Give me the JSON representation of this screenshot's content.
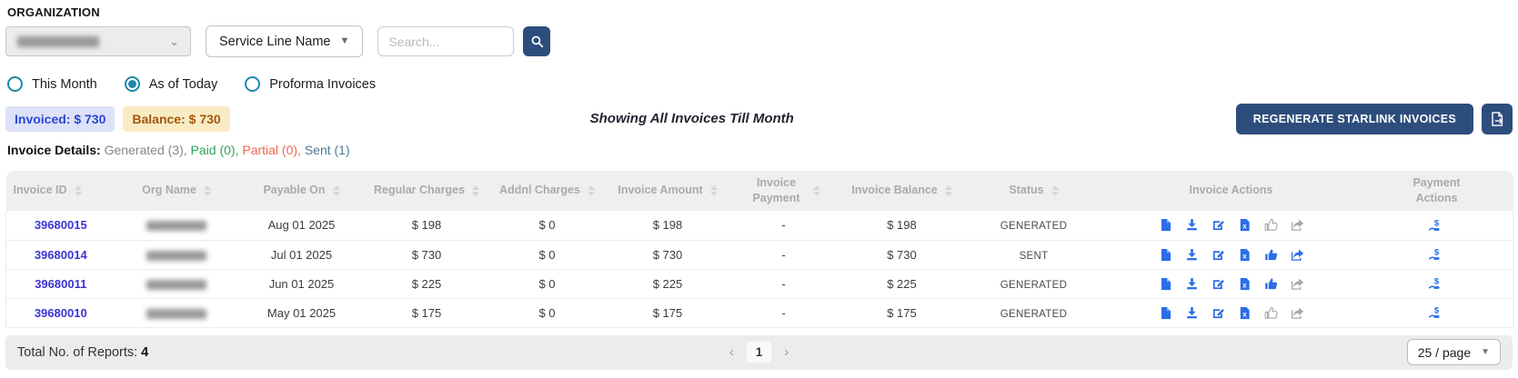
{
  "filters": {
    "organization_label": "ORGANIZATION",
    "service_line_dropdown": "Service Line Name",
    "search_placeholder": "Search...",
    "radios": [
      {
        "label": "This Month",
        "selected": false
      },
      {
        "label": "As of Today",
        "selected": true
      },
      {
        "label": "Proforma Invoices",
        "selected": false
      }
    ]
  },
  "summary": {
    "invoiced_badge": "Invoiced: $ 730",
    "balance_badge": "Balance: $ 730",
    "showing_text": "Showing All Invoices Till Month",
    "regenerate_button": "REGENERATE STARLINK INVOICES",
    "details_label": "Invoice Details:",
    "generated": "Generated (3),",
    "paid": "Paid (0),",
    "partial": "Partial (0),",
    "sent": "Sent (1)"
  },
  "table": {
    "columns": [
      "Invoice ID",
      "Org Name",
      "Payable On",
      "Regular Charges",
      "Addnl Charges",
      "Invoice Amount",
      "Invoice Payment",
      "Invoice Balance",
      "Status",
      "Invoice Actions",
      "Payment Actions"
    ],
    "rows": [
      {
        "invoice_id": "39680015",
        "payable_on": "Aug 01 2025",
        "regular_charges": "$ 198",
        "addnl_charges": "$ 0",
        "invoice_amount": "$ 198",
        "invoice_payment": "-",
        "invoice_balance": "$ 198",
        "status": "GENERATED",
        "approve_active": false,
        "share_active": false
      },
      {
        "invoice_id": "39680014",
        "payable_on": "Jul 01 2025",
        "regular_charges": "$ 730",
        "addnl_charges": "$ 0",
        "invoice_amount": "$ 730",
        "invoice_payment": "-",
        "invoice_balance": "$ 730",
        "status": "SENT",
        "approve_active": true,
        "share_active": true
      },
      {
        "invoice_id": "39680011",
        "payable_on": "Jun 01 2025",
        "regular_charges": "$ 225",
        "addnl_charges": "$ 0",
        "invoice_amount": "$ 225",
        "invoice_payment": "-",
        "invoice_balance": "$ 225",
        "status": "GENERATED",
        "approve_active": true,
        "share_active": false
      },
      {
        "invoice_id": "39680010",
        "payable_on": "May 01 2025",
        "regular_charges": "$ 175",
        "addnl_charges": "$ 0",
        "invoice_amount": "$ 175",
        "invoice_payment": "-",
        "invoice_balance": "$ 175",
        "status": "GENERATED",
        "approve_active": false,
        "share_active": false
      }
    ]
  },
  "footer": {
    "total_label": "Total No. of Reports:",
    "total_value": "4",
    "prev_arrow": "‹",
    "next_arrow": "›",
    "current_page": "1",
    "page_size": "25 / page"
  },
  "colors": {
    "accent_navy": "#2d4d7c",
    "action_blue": "#2c6de8",
    "inactive_gray": "#a8a8a8",
    "invoice_id_link": "#3b33d1",
    "radio_teal": "#1f87ae",
    "invoiced_badge_bg": "#dde2f8",
    "invoiced_badge_text": "#2b46d6",
    "balance_badge_bg": "#f9ecc4",
    "balance_badge_text": "#a4570e",
    "paid_green": "#2ea05c",
    "partial_orange": "#ef6550",
    "sent_teal": "#4a7b92",
    "header_gray_bg": "#efefef"
  }
}
